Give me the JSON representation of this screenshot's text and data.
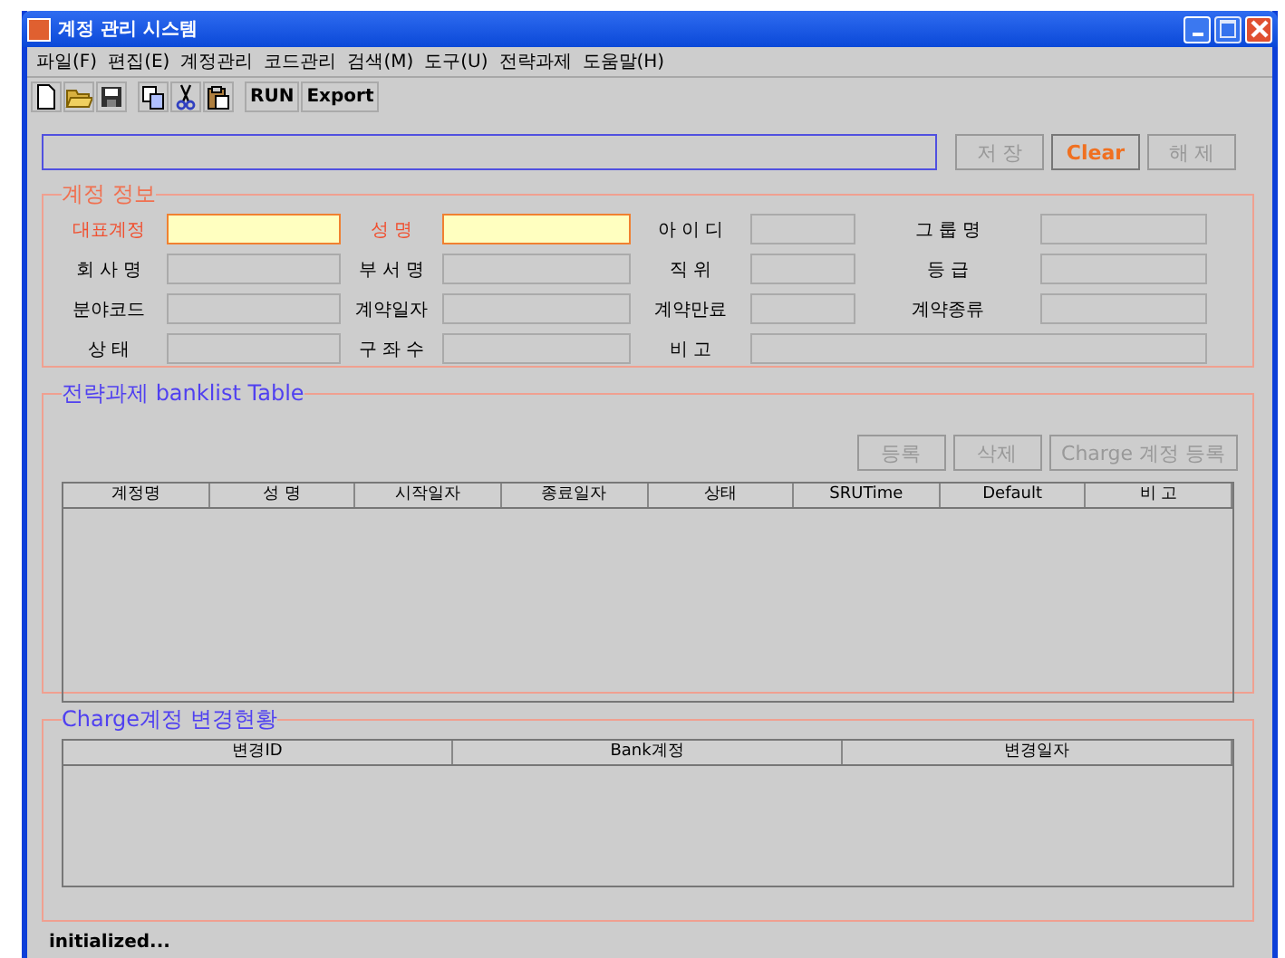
{
  "window": {
    "title": "계정 관리 시스템"
  },
  "menu": [
    "파일(F)",
    "편집(E)",
    "계정관리",
    "코드관리",
    "검색(M)",
    "도구(U)",
    "전략과제",
    "도움말(H)"
  ],
  "toolbar": {
    "icons": [
      {
        "kind": "new"
      },
      {
        "kind": "open"
      },
      {
        "kind": "save"
      },
      {
        "kind": "sep"
      },
      {
        "kind": "copy"
      },
      {
        "kind": "cut"
      },
      {
        "kind": "paste"
      },
      {
        "kind": "sep"
      }
    ],
    "buttons": [
      "RUN",
      "Export"
    ]
  },
  "top_buttons": [
    {
      "label": "저 장",
      "disabled": true,
      "accent": false
    },
    {
      "label": "Clear",
      "disabled": false,
      "accent": true
    },
    {
      "label": "해 제",
      "disabled": true,
      "accent": false
    }
  ],
  "account_info": {
    "title": "계정 정보",
    "rows": [
      [
        {
          "label": "대표계정",
          "required": true
        },
        {
          "label": "성  명",
          "required": true
        },
        {
          "label": "아 이 디",
          "required": false
        },
        {
          "label": "그 룹 명",
          "required": false
        }
      ],
      [
        {
          "label": "회 사 명",
          "required": false
        },
        {
          "label": "부 서 명",
          "required": false
        },
        {
          "label": "직 위",
          "required": false
        },
        {
          "label": "등 급",
          "required": false
        }
      ],
      [
        {
          "label": "분야코드",
          "required": false
        },
        {
          "label": "계약일자",
          "required": false
        },
        {
          "label": "계약만료",
          "required": false
        },
        {
          "label": "계약종류",
          "required": false
        }
      ],
      [
        {
          "label": "상 태",
          "required": false
        },
        {
          "label": "구 좌 수",
          "required": false
        },
        {
          "label": "비 고",
          "required": false
        }
      ]
    ]
  },
  "banklist": {
    "title": "전략과제 banklist Table",
    "buttons": [
      {
        "label": "등록",
        "disabled": true
      },
      {
        "label": "삭제",
        "disabled": true
      },
      {
        "label": "Charge 계정 등록",
        "disabled": true
      }
    ],
    "columns": [
      "계정명",
      "성 명",
      "시작일자",
      "종료일자",
      "상태",
      "SRUTime",
      "Default",
      "비 고"
    ]
  },
  "charge_history": {
    "title": "Charge계정 변경현황",
    "columns": [
      "변경ID",
      "Bank계정",
      "변경일자"
    ]
  },
  "status_bar": "initialized..."
}
